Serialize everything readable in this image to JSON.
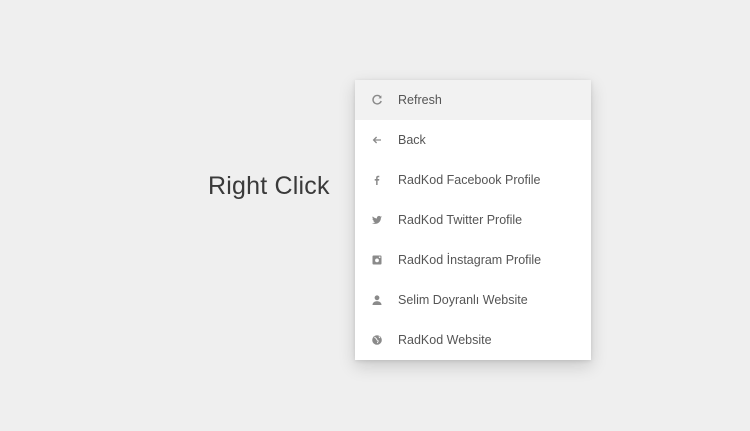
{
  "hint_text": "Right Click",
  "menu": {
    "items": [
      {
        "label": "Refresh",
        "icon": "refresh-icon"
      },
      {
        "label": "Back",
        "icon": "arrow-left-icon"
      },
      {
        "label": "RadKod Facebook Profile",
        "icon": "facebook-icon"
      },
      {
        "label": "RadKod Twitter Profile",
        "icon": "twitter-icon"
      },
      {
        "label": "RadKod İnstagram Profile",
        "icon": "instagram-icon"
      },
      {
        "label": "Selim Doyranlı Website",
        "icon": "user-icon"
      },
      {
        "label": "RadKod Website",
        "icon": "globe-icon"
      }
    ]
  },
  "colors": {
    "background": "#efefef",
    "menu_background": "#ffffff",
    "hover_row": "#f2f2f2",
    "text": "#555555",
    "icon": "#8a8a8a"
  }
}
